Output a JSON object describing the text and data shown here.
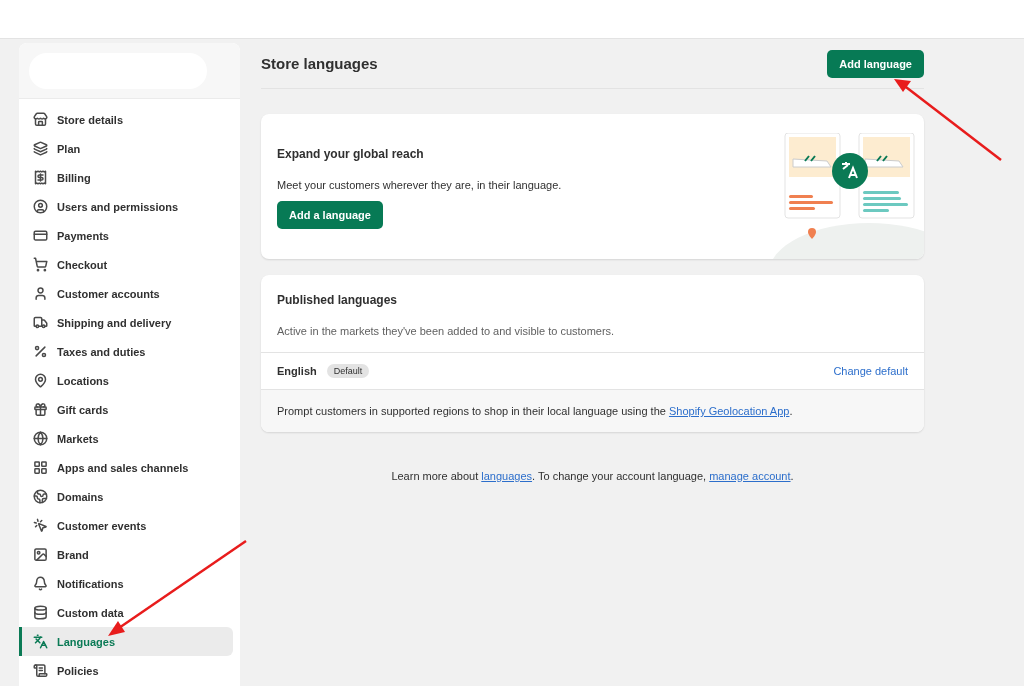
{
  "sidebar": {
    "items": [
      {
        "label": "Store details",
        "selected": false
      },
      {
        "label": "Plan",
        "selected": false
      },
      {
        "label": "Billing",
        "selected": false
      },
      {
        "label": "Users and permissions",
        "selected": false
      },
      {
        "label": "Payments",
        "selected": false
      },
      {
        "label": "Checkout",
        "selected": false
      },
      {
        "label": "Customer accounts",
        "selected": false
      },
      {
        "label": "Shipping and delivery",
        "selected": false
      },
      {
        "label": "Taxes and duties",
        "selected": false
      },
      {
        "label": "Locations",
        "selected": false
      },
      {
        "label": "Gift cards",
        "selected": false
      },
      {
        "label": "Markets",
        "selected": false
      },
      {
        "label": "Apps and sales channels",
        "selected": false
      },
      {
        "label": "Domains",
        "selected": false
      },
      {
        "label": "Customer events",
        "selected": false
      },
      {
        "label": "Brand",
        "selected": false
      },
      {
        "label": "Notifications",
        "selected": false
      },
      {
        "label": "Custom data",
        "selected": false
      },
      {
        "label": "Languages",
        "selected": true
      },
      {
        "label": "Policies",
        "selected": false
      }
    ]
  },
  "page": {
    "title": "Store languages",
    "primary_button": "Add language"
  },
  "promo_card": {
    "title": "Expand your global reach",
    "text": "Meet your customers wherever they are, in their language.",
    "button": "Add a language"
  },
  "published_card": {
    "title": "Published languages",
    "subtitle": "Active in the markets they've been added to and visible to customers.",
    "languages": [
      {
        "name": "English",
        "badge": "Default",
        "action": "Change default"
      }
    ],
    "note": {
      "before": "Prompt customers in supported regions to shop in their local language using the ",
      "link": "Shopify Geolocation App",
      "after": "."
    }
  },
  "footer": {
    "parts": [
      {
        "kind": "text",
        "text": "Learn more about "
      },
      {
        "kind": "link",
        "text": "languages"
      },
      {
        "kind": "text",
        "text": ". To change your account language, "
      },
      {
        "kind": "link",
        "text": "manage account"
      },
      {
        "kind": "text",
        "text": "."
      }
    ]
  }
}
